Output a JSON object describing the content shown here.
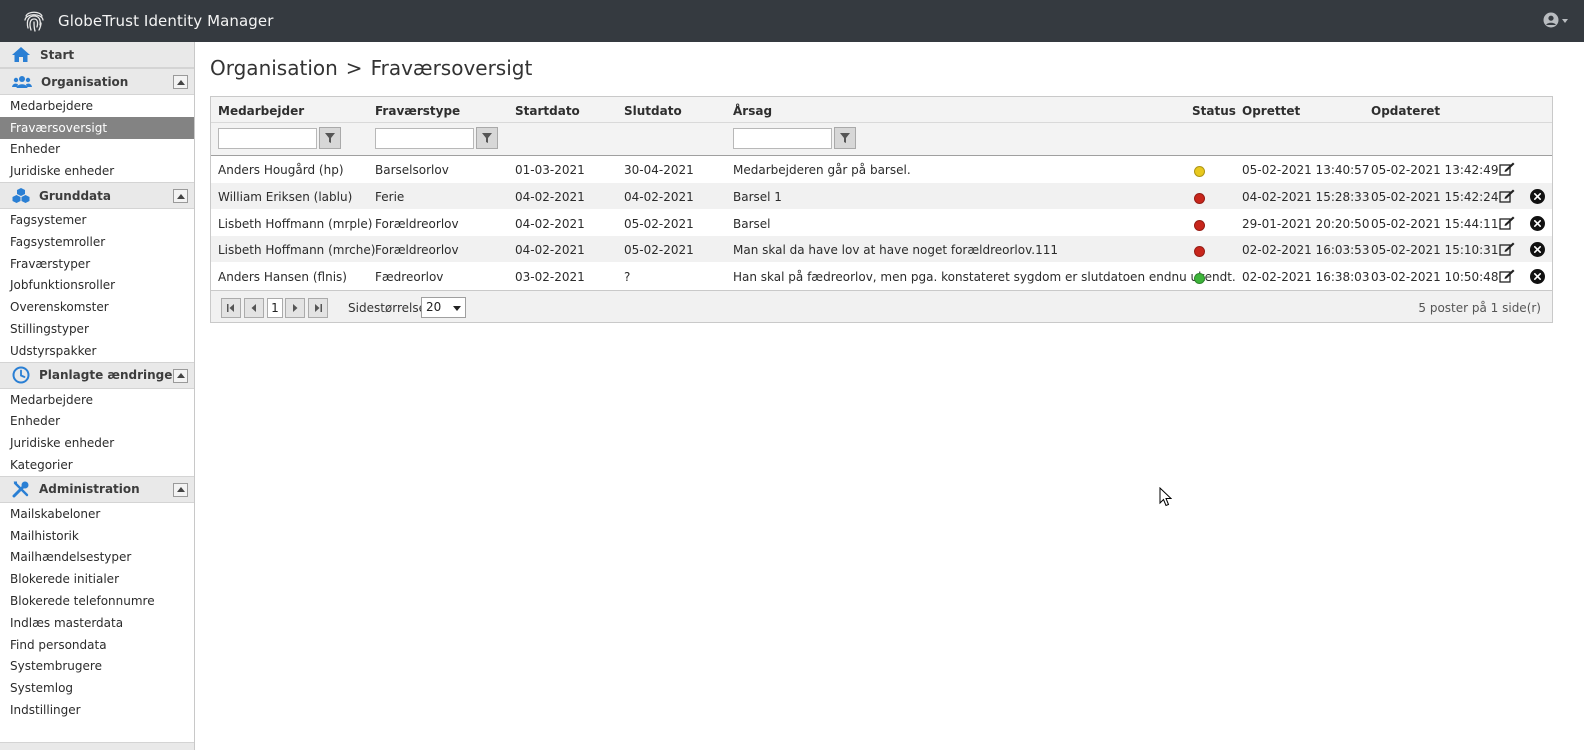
{
  "app": {
    "title": "GlobeTrust Identity Manager"
  },
  "sidebar": {
    "start_label": "Start",
    "sections": [
      {
        "title": "Organisation",
        "icon": "users-icon",
        "items": [
          "Medarbejdere",
          "Fraværsoversigt",
          "Enheder",
          "Juridiske enheder"
        ],
        "active_index": 1
      },
      {
        "title": "Grunddata",
        "icon": "cubes-icon",
        "items": [
          "Fagsystemer",
          "Fagsystemroller",
          "Fraværstyper",
          "Jobfunktionsroller",
          "Overenskomster",
          "Stillingstyper",
          "Udstyrspakker"
        ]
      },
      {
        "title": "Planlagte ændringer",
        "icon": "clock-icon",
        "items": [
          "Medarbejdere",
          "Enheder",
          "Juridiske enheder",
          "Kategorier"
        ]
      },
      {
        "title": "Administration",
        "icon": "tools-icon",
        "items": [
          "Mailskabeloner",
          "Mailhistorik",
          "Mailhændelsestyper",
          "Blokerede initialer",
          "Blokerede telefonnumre",
          "Indlæs masterdata",
          "Find persondata",
          "Systembrugere",
          "Systemlog",
          "Indstillinger"
        ]
      }
    ]
  },
  "breadcrumb": {
    "parent": "Organisation",
    "separator": ">",
    "current": "Fraværsoversigt"
  },
  "grid": {
    "columns": [
      "Medarbejder",
      "Fraværstype",
      "Startdato",
      "Slutdato",
      "Årsag",
      "Status",
      "Oprettet",
      "Opdateret"
    ],
    "rows": [
      {
        "medarbejder": "Anders Hougård (hp)",
        "type": "Barselsorlov",
        "start": "01-03-2021",
        "slut": "30-04-2021",
        "aarsag": "Medarbejderen går på barsel.",
        "status": "yellow",
        "oprettet": "05-02-2021 13:40:57",
        "opdateret": "05-02-2021 13:42:49",
        "deletable": false
      },
      {
        "medarbejder": "William Eriksen (lablu)",
        "type": "Ferie",
        "start": "04-02-2021",
        "slut": "04-02-2021",
        "aarsag": "Barsel 1",
        "status": "red",
        "oprettet": "04-02-2021 15:28:33",
        "opdateret": "05-02-2021 15:42:24",
        "deletable": true
      },
      {
        "medarbejder": "Lisbeth Hoffmann (mrple)",
        "type": "Forældreorlov",
        "start": "04-02-2021",
        "slut": "05-02-2021",
        "aarsag": "Barsel",
        "status": "red",
        "oprettet": "29-01-2021 20:20:50",
        "opdateret": "05-02-2021 15:44:11",
        "deletable": true
      },
      {
        "medarbejder": "Lisbeth Hoffmann (mrche)",
        "type": "Forældreorlov",
        "start": "04-02-2021",
        "slut": "05-02-2021",
        "aarsag": "Man skal da have lov at have noget forældreorlov.111",
        "status": "red",
        "oprettet": "02-02-2021 16:03:53",
        "opdateret": "05-02-2021 15:10:31",
        "deletable": true
      },
      {
        "medarbejder": "Anders Hansen (flnis)",
        "type": "Fædreorlov",
        "start": "03-02-2021",
        "slut": "?",
        "aarsag": "Han skal på fædreorlov, men pga. konstateret sygdom er slutdatoen endnu ukendt.",
        "status": "green",
        "oprettet": "02-02-2021 16:38:03",
        "opdateret": "03-02-2021 10:50:48",
        "deletable": true
      }
    ],
    "status_colors": {
      "yellow": "#e8c81e",
      "red": "#c8261c",
      "green": "#3db43a"
    }
  },
  "pager": {
    "current_page": "1",
    "page_size_label": "Sidestørrelse:",
    "page_size": "20",
    "info": "5 poster på 1 side(r)"
  },
  "colors": {
    "topbar": "#353a40",
    "accent_blue": "#2a7fd4",
    "active_item": "#838383"
  }
}
